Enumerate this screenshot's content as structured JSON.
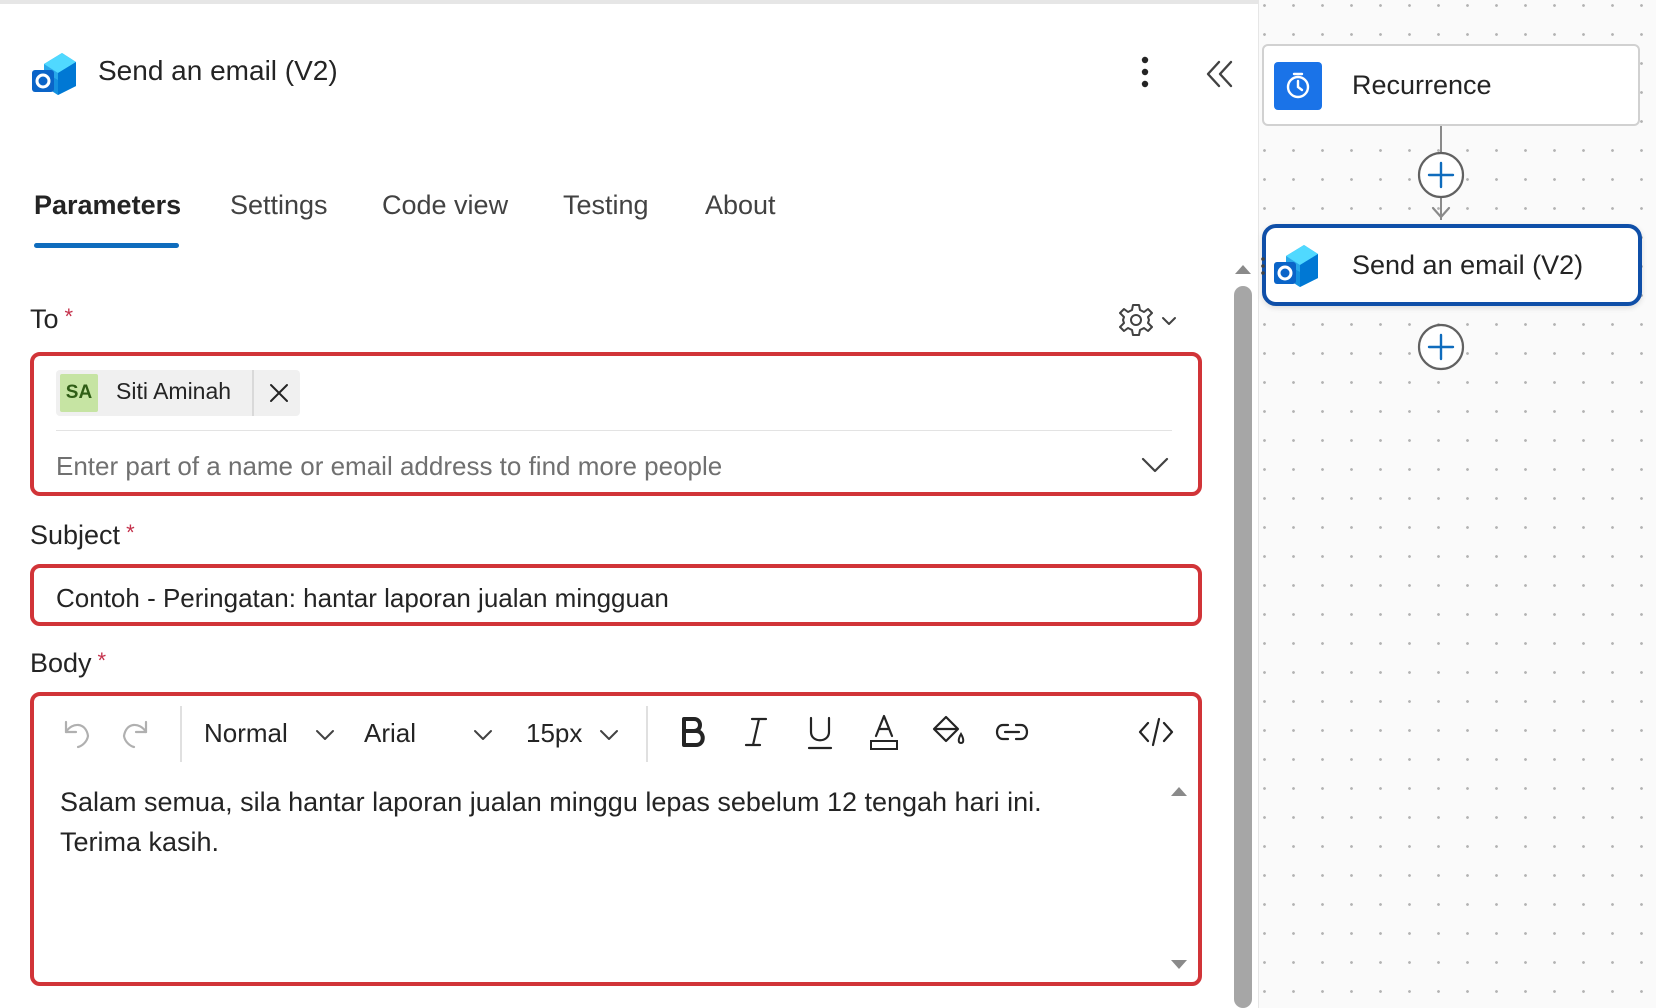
{
  "header": {
    "title": "Send an email (V2)",
    "icon": "outlook-icon",
    "more_icon": "more-vertical-icon",
    "collapse_icon": "double-chevron-left-icon"
  },
  "tabs": [
    {
      "label": "Parameters",
      "active": true
    },
    {
      "label": "Settings",
      "active": false
    },
    {
      "label": "Code view",
      "active": false
    },
    {
      "label": "Testing",
      "active": false
    },
    {
      "label": "About",
      "active": false
    }
  ],
  "fields": {
    "to": {
      "label": "To",
      "required_mark": "*",
      "recipients": [
        {
          "initials": "SA",
          "name": "Siti Aminah"
        }
      ],
      "placeholder": "Enter part of a name or email address to find more people"
    },
    "subject": {
      "label": "Subject",
      "required_mark": "*",
      "value": "Contoh - Peringatan: hantar laporan jualan mingguan"
    },
    "body": {
      "label": "Body",
      "required_mark": "*",
      "toolbar": {
        "style": "Normal",
        "font": "Arial",
        "size": "15px"
      },
      "lines": [
        "Salam semua, sila hantar laporan jualan minggu lepas sebelum 12 tengah hari ini.",
        "Terima kasih."
      ]
    }
  },
  "canvas": {
    "nodes": [
      {
        "label": "Recurrence",
        "icon": "clock-icon"
      },
      {
        "label": "Send an email (V2)",
        "icon": "outlook-icon",
        "selected": true
      }
    ]
  },
  "colors": {
    "accent": "#0f6cbd",
    "error_border": "#d13438",
    "required": "#c4314b",
    "recurrence_icon_bg": "#1a73e8",
    "selected_node_border": "#0f4fa8"
  }
}
